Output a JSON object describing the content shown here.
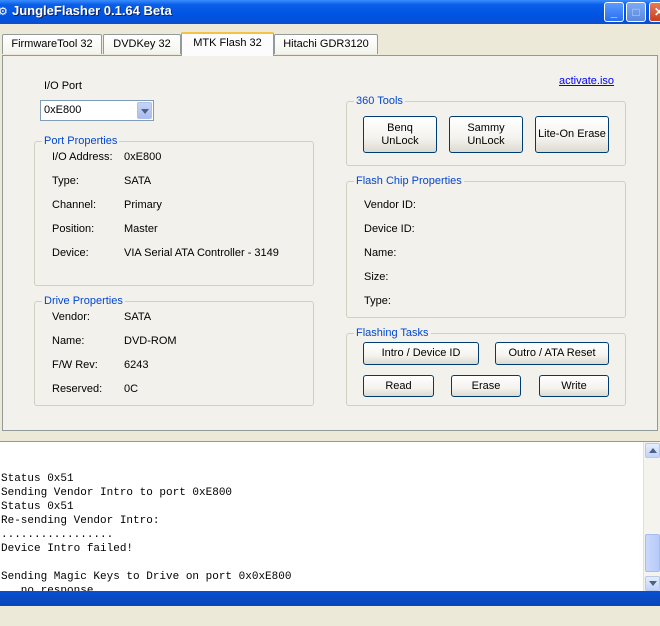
{
  "window": {
    "title": "JungleFlasher 0.1.64 Beta"
  },
  "tabs": [
    "FirmwareTool 32",
    "DVDKey 32",
    "MTK Flash 32",
    "Hitachi GDR3120"
  ],
  "io_port": {
    "label": "I/O Port",
    "selected": "0xE800"
  },
  "activate_link": "activate.iso",
  "port_properties": {
    "title": "Port Properties",
    "rows": [
      {
        "label": "I/O Address:",
        "value": "0xE800"
      },
      {
        "label": "Type:",
        "value": "SATA"
      },
      {
        "label": "Channel:",
        "value": "Primary"
      },
      {
        "label": "Position:",
        "value": "Master"
      },
      {
        "label": "Device:",
        "value": "VIA Serial ATA Controller - 3149"
      }
    ]
  },
  "drive_properties": {
    "title": "Drive Properties",
    "rows": [
      {
        "label": "Vendor:",
        "value": "SATA"
      },
      {
        "label": "Name:",
        "value": "DVD-ROM"
      },
      {
        "label": "F/W Rev:",
        "value": "6243"
      },
      {
        "label": "Reserved:",
        "value": "0C"
      }
    ]
  },
  "tools_360": {
    "title": "360 Tools",
    "benq": "Benq\nUnLock",
    "sammy": "Sammy\nUnLock",
    "liteon": "Lite-On Erase"
  },
  "flash_chip": {
    "title": "Flash Chip Properties",
    "rows": [
      "Vendor ID:",
      "Device ID:",
      "Name:",
      "Size:",
      "Type:"
    ]
  },
  "flashing_tasks": {
    "title": "Flashing Tasks",
    "intro": "Intro / Device ID",
    "outro": "Outro / ATA Reset",
    "read": "Read",
    "erase": "Erase",
    "write": "Write"
  },
  "log": {
    "lines": [
      "Status 0x51",
      "Sending Vendor Intro to port 0xE800",
      "Status 0x51",
      "Re-sending Vendor Intro:",
      ".................",
      "Device Intro failed!",
      "",
      "Sending Magic Keys to Drive on port 0x0xE800",
      "   no response"
    ]
  }
}
